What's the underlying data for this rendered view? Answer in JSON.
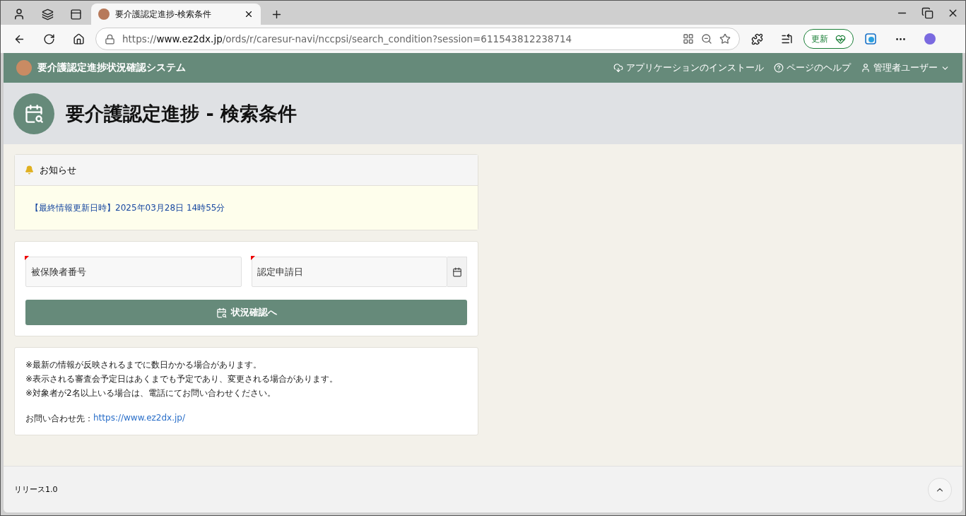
{
  "browser": {
    "tab": {
      "title": "要介護認定進捗-検索条件",
      "selected": true
    },
    "url": {
      "scheme": "https://",
      "host": "www.ez2dx.jp",
      "path": "/ords/r/caresur-navi/nccpsi/search_condition?session=611543812238714"
    },
    "update_button": "更新"
  },
  "app_header": {
    "title": "要介護認定進捗状況確認システム",
    "actions": [
      {
        "kind": "install",
        "label": "アプリケーションのインストール"
      },
      {
        "kind": "help",
        "label": "ページのヘルプ"
      },
      {
        "kind": "user",
        "label": "管理者ユーザー"
      }
    ]
  },
  "page_title": "要介護認定進捗 - 検索条件",
  "notice": {
    "title": "お知らせ",
    "text": "【最終情報更新日時】2025年03月28日 14時55分"
  },
  "form": {
    "fields": [
      {
        "kind": "text",
        "placeholder": "被保険者番号",
        "required": true
      },
      {
        "kind": "date",
        "placeholder": "認定申請日",
        "required": true
      }
    ],
    "submit": "状況確認へ"
  },
  "notes": {
    "lines": [
      "※最新の情報が反映されるまでに数日かかる場合があります。",
      "※表示される審査会予定日はあくまでも予定であり、変更される場合があります。",
      "※対象者が2名以上いる場合は、電話にてお問い合わせください。"
    ],
    "contact_label": "お問い合わせ先：",
    "contact_link": "https://www.ez2dx.jp/"
  },
  "footer": {
    "release": "リリース1.0"
  }
}
